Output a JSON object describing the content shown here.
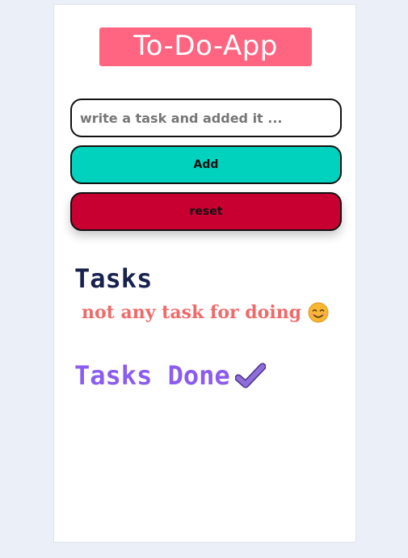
{
  "app": {
    "title": "To-Do-App"
  },
  "form": {
    "input_placeholder": "write a task and added it ...",
    "input_value": "",
    "add_label": "Add",
    "reset_label": "reset"
  },
  "tasks": {
    "heading": "Tasks",
    "empty_message": "not any task for doing",
    "empty_icon": "smiling-face-icon",
    "items": []
  },
  "done": {
    "heading": "Tasks Done",
    "icon": "check-mark-icon",
    "items": []
  },
  "colors": {
    "background": "#ebeff8",
    "title_bg": "#ff6480",
    "add_button": "#00d2be",
    "reset_button": "#c80032",
    "tasks_heading": "#17224d",
    "empty_message": "#f06a6a",
    "done_heading": "#8b5cf0"
  }
}
